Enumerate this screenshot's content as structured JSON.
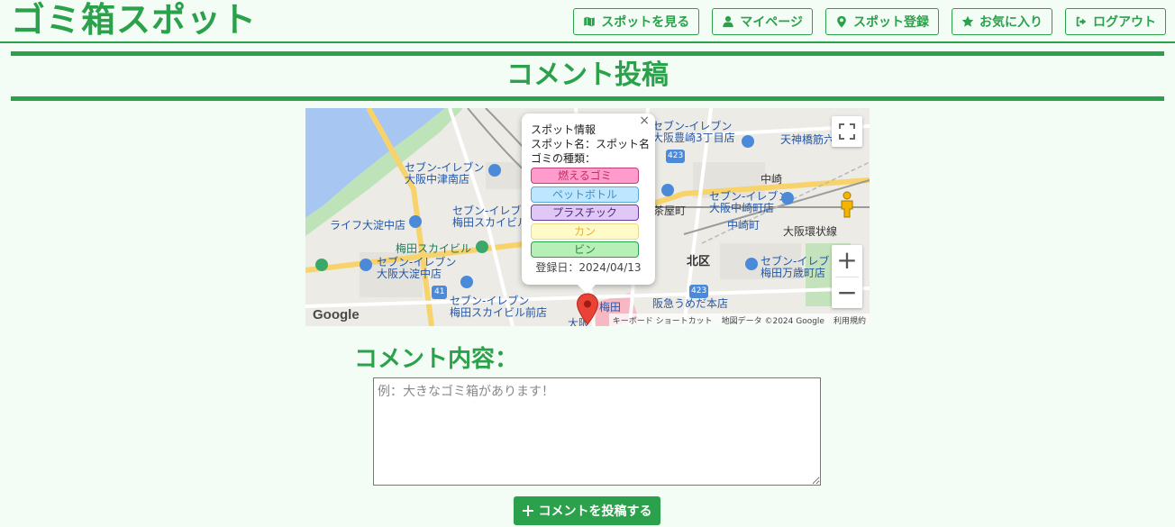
{
  "header": {
    "brand": "ゴミ箱スポット",
    "nav": [
      {
        "label": "スポットを見る",
        "icon": "map-icon"
      },
      {
        "label": "マイページ",
        "icon": "user-icon"
      },
      {
        "label": "スポット登録",
        "icon": "map-pin-icon"
      },
      {
        "label": "お気に入り",
        "icon": "star-icon"
      },
      {
        "label": "ログアウト",
        "icon": "logout-icon"
      }
    ]
  },
  "page_title": "コメント投稿",
  "map": {
    "labels": {
      "seven_nakatsu_1": "セブン-イレブン",
      "seven_nakatsu_2": "大阪中津南店",
      "seven_toyosaki_1": "セブン-イレブン",
      "seven_toyosaki_2": "大阪豊崎3丁目店",
      "tenjin": "天神橋筋六",
      "nakazaki": "中崎",
      "seven_nakazakicho_1": "セブン-イレブン",
      "seven_nakazakicho_2": "大阪中崎町店",
      "nakazakicho": "中崎町",
      "chayamachi": "茶屋町",
      "life": "ライフ大淀中店",
      "seven_umeda_east_1": "セブン-イレブ",
      "seven_umeda_east_2": "梅田スカイビル東",
      "umeda_sky": "梅田スカイビル",
      "seven_oyodo_1": "セブン-イレブン",
      "seven_oyodo_2": "大阪大淀中店",
      "kita_ku": "北区",
      "osaka_loop": "大阪環状線",
      "seven_mansai_1": "セブン-イレブ",
      "seven_mansai_2": "梅田万歳町店",
      "seven_skybldg_front_1": "セブン-イレブン",
      "seven_skybldg_front_2": "梅田スカイビル前店",
      "umeda": "梅田",
      "hankyu": "阪急うめだ本店",
      "osaka": "大阪",
      "route_423a": "423",
      "route_423b": "423",
      "route_41": "41",
      "google": "Google",
      "shortcuts": "キーボード ショートカット",
      "map_data": "地図データ ©2024 Google",
      "terms": "利用規約"
    },
    "info_window": {
      "heading": "スポット情報",
      "spot_name": "スポット名：スポット名",
      "types_label": "ゴミの種類：",
      "types": [
        {
          "label": "燃えるゴミ",
          "bg": "#ff9ccb",
          "border": "#c0407a",
          "color": "#c0305a"
        },
        {
          "label": "ペットボトル",
          "bg": "#bfe6ff",
          "border": "#5aa8d8",
          "color": "#3a90c8"
        },
        {
          "label": "プラスチック",
          "bg": "#e0c8f6",
          "border": "#6a3a9a",
          "color": "#4a2a7a"
        },
        {
          "label": "カン",
          "bg": "#fffbc8",
          "border": "#e8d890",
          "color": "#e0b030"
        },
        {
          "label": "ビン",
          "bg": "#b6f0b6",
          "border": "#2aa14a",
          "color": "#2a8a3a"
        }
      ],
      "date": "登録日：2024/04/13",
      "close": "×"
    }
  },
  "form": {
    "label": "コメント内容：",
    "placeholder": "例：大きなゴミ箱があります！",
    "value": "",
    "submit_label": "コメントを投稿する"
  },
  "colors": {
    "accent": "#2aa14a",
    "background": "#f3fdf6"
  }
}
